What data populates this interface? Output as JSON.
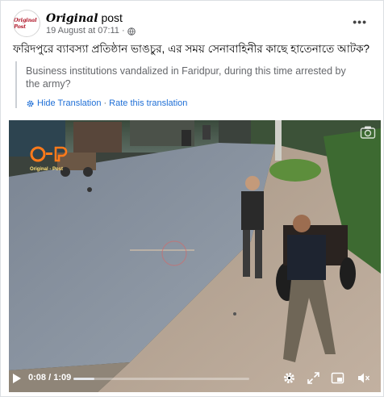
{
  "post": {
    "avatar_text": "Original Post",
    "page_name_brand": "Original",
    "page_name_suffix": " post",
    "timestamp": "19 August at 07:11 ·",
    "privacy_icon": "globe-icon",
    "more_icon": "more-options-icon",
    "text": "ফরিদপুরে ব্যাবস্যা প্রতিষ্ঠান ভাঙচুর, এর সময় সেনাবাহিনীর কাছে হাতেনাতে আটক?"
  },
  "translation": {
    "text": "Business institutions vandalized in Faridpur, during this time arrested by the army?",
    "hide_label": "Hide Translation",
    "separator": "·",
    "rate_label": "Rate this translation"
  },
  "video": {
    "watermark": "O-P",
    "watermark_sub": "Original - Post",
    "current_time": "0:08",
    "duration": "1:09",
    "time_separator": " / ",
    "progress": 0.12,
    "controls": [
      "play-icon",
      "gear-icon",
      "expand-icon",
      "picture-in-picture-icon",
      "volume-icon"
    ],
    "colors": {
      "accent": "#1f6fd6",
      "progress_track": "#a8abad",
      "progress_fill": "#e4e6eb"
    }
  }
}
